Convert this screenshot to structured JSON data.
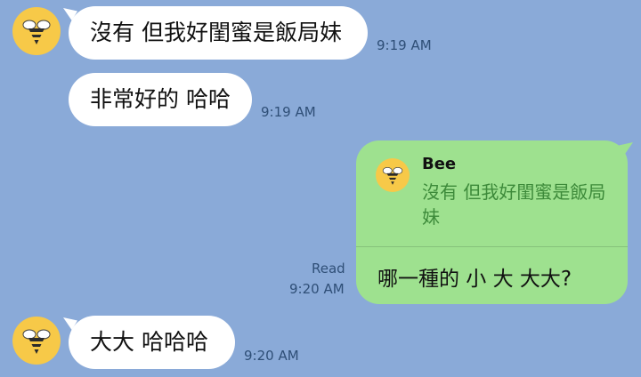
{
  "messages": [
    {
      "sender": "incoming",
      "text": "沒有 但我好閨蜜是飯局妹",
      "time": "9:19 AM",
      "avatar_icon": "bee-icon"
    },
    {
      "sender": "incoming",
      "text": "非常好的 哈哈",
      "time": "9:19 AM"
    },
    {
      "sender": "outgoing",
      "reply_to": {
        "name": "Bee",
        "text": "沒有 但我好閨蜜是飯局妹",
        "avatar_icon": "bee-icon"
      },
      "text": "哪一種的 小 大 大大?",
      "status": "Read",
      "time": "9:20 AM"
    },
    {
      "sender": "incoming",
      "text": "大大 哈哈哈",
      "time": "9:20 AM",
      "avatar_icon": "bee-icon"
    }
  ],
  "colors": {
    "background": "#8aaad8",
    "incoming_bubble": "#ffffff",
    "outgoing_bubble": "#9ee18f",
    "avatar": "#f7c948"
  }
}
